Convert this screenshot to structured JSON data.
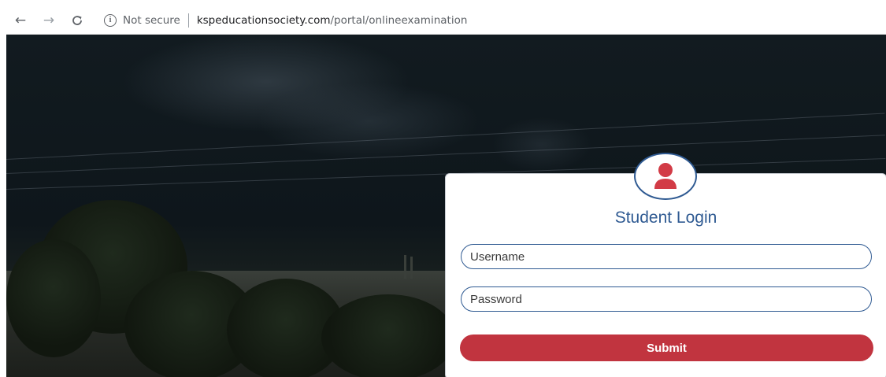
{
  "browser": {
    "back_icon": "arrow-left-icon",
    "forward_icon": "arrow-right-icon",
    "reload_icon": "reload-icon",
    "security_icon": "info-icon",
    "security_label": "Not secure",
    "url_host": "kspeducationsociety.com",
    "url_path": "/portal/onlineexamination"
  },
  "login": {
    "avatar_icon": "user-icon",
    "title": "Student Login",
    "username_placeholder": "Username",
    "password_placeholder": "Password",
    "submit_label": "Submit"
  },
  "colors": {
    "brand_blue": "#2f5a92",
    "submit_red": "#c1343f",
    "avatar_red": "#d23b46"
  }
}
